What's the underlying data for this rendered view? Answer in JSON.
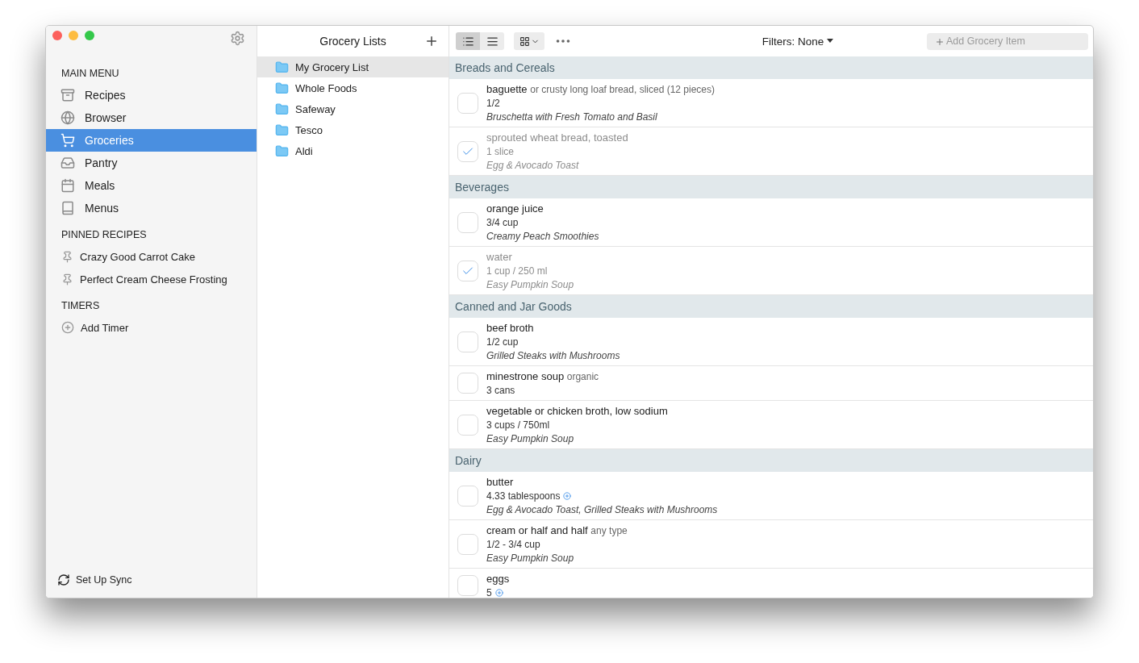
{
  "sidebar": {
    "sections": [
      {
        "title": "MAIN MENU",
        "items": [
          {
            "kind": "recipes",
            "label": "Recipes",
            "selected": false
          },
          {
            "kind": "browser",
            "label": "Browser",
            "selected": false
          },
          {
            "kind": "groceries",
            "label": "Groceries",
            "selected": true
          },
          {
            "kind": "pantry",
            "label": "Pantry",
            "selected": false
          },
          {
            "kind": "meals",
            "label": "Meals",
            "selected": false
          },
          {
            "kind": "menus",
            "label": "Menus",
            "selected": false
          }
        ]
      },
      {
        "title": "PINNED RECIPES",
        "items": [
          {
            "kind": "pin",
            "label": "Crazy Good Carrot Cake",
            "selected": false
          },
          {
            "kind": "pin",
            "label": "Perfect Cream Cheese Frosting",
            "selected": false
          }
        ]
      },
      {
        "title": "TIMERS",
        "items": [
          {
            "kind": "add",
            "label": "Add Timer",
            "selected": false
          }
        ]
      }
    ],
    "footer": "Set Up Sync"
  },
  "lists_pane": {
    "title": "Grocery Lists",
    "items": [
      {
        "label": "My Grocery List",
        "selected": true
      },
      {
        "label": "Whole Foods",
        "selected": false
      },
      {
        "label": "Safeway",
        "selected": false
      },
      {
        "label": "Tesco",
        "selected": false
      },
      {
        "label": "Aldi",
        "selected": false
      }
    ]
  },
  "toolbar": {
    "views": [
      {
        "kind": "detail",
        "selected": true
      },
      {
        "kind": "compact",
        "selected": false
      }
    ],
    "filters": "Filters: None",
    "add_item": {
      "placeholder": "Add Grocery Item"
    }
  },
  "groups": [
    {
      "title": "Breads and Cereals",
      "items": [
        {
          "name": "baguette",
          "note": "or crusty long loaf bread, sliced (12 pieces)",
          "amount": "1/2",
          "combined": false,
          "recipe": "Bruschetta with Fresh Tomato and Basil",
          "checked": false
        },
        {
          "name": "sprouted wheat bread, toasted",
          "amount": "1 slice",
          "combined": false,
          "recipe": "Egg & Avocado Toast",
          "checked": true
        }
      ]
    },
    {
      "title": "Beverages",
      "items": [
        {
          "name": "orange juice",
          "amount": "3/4 cup",
          "combined": false,
          "recipe": "Creamy Peach Smoothies",
          "checked": false
        },
        {
          "name": "water",
          "amount": "1 cup / 250 ml",
          "combined": false,
          "recipe": "Easy Pumpkin Soup",
          "checked": true
        }
      ]
    },
    {
      "title": "Canned and Jar Goods",
      "items": [
        {
          "name": "beef broth",
          "amount": "1/2 cup",
          "combined": false,
          "recipe": "Grilled Steaks with Mushrooms",
          "checked": false
        },
        {
          "name": "minestrone soup",
          "note": "organic",
          "amount": "3 cans",
          "combined": false,
          "checked": false
        },
        {
          "name": "vegetable or chicken broth, low sodium",
          "amount": "3 cups / 750ml",
          "combined": false,
          "recipe": "Easy Pumpkin Soup",
          "checked": false
        }
      ]
    },
    {
      "title": "Dairy",
      "items": [
        {
          "name": "butter",
          "amount": "4.33 tablespoons",
          "combined": true,
          "recipe": "Egg & Avocado Toast, Grilled Steaks with Mushrooms",
          "checked": false
        },
        {
          "name": "cream or half and half",
          "note": "any type",
          "amount": "1/2 - 3/4 cup",
          "combined": false,
          "recipe": "Easy Pumpkin Soup",
          "checked": false
        },
        {
          "name": "eggs",
          "amount": "5",
          "combined": true,
          "checked": false
        }
      ]
    }
  ]
}
